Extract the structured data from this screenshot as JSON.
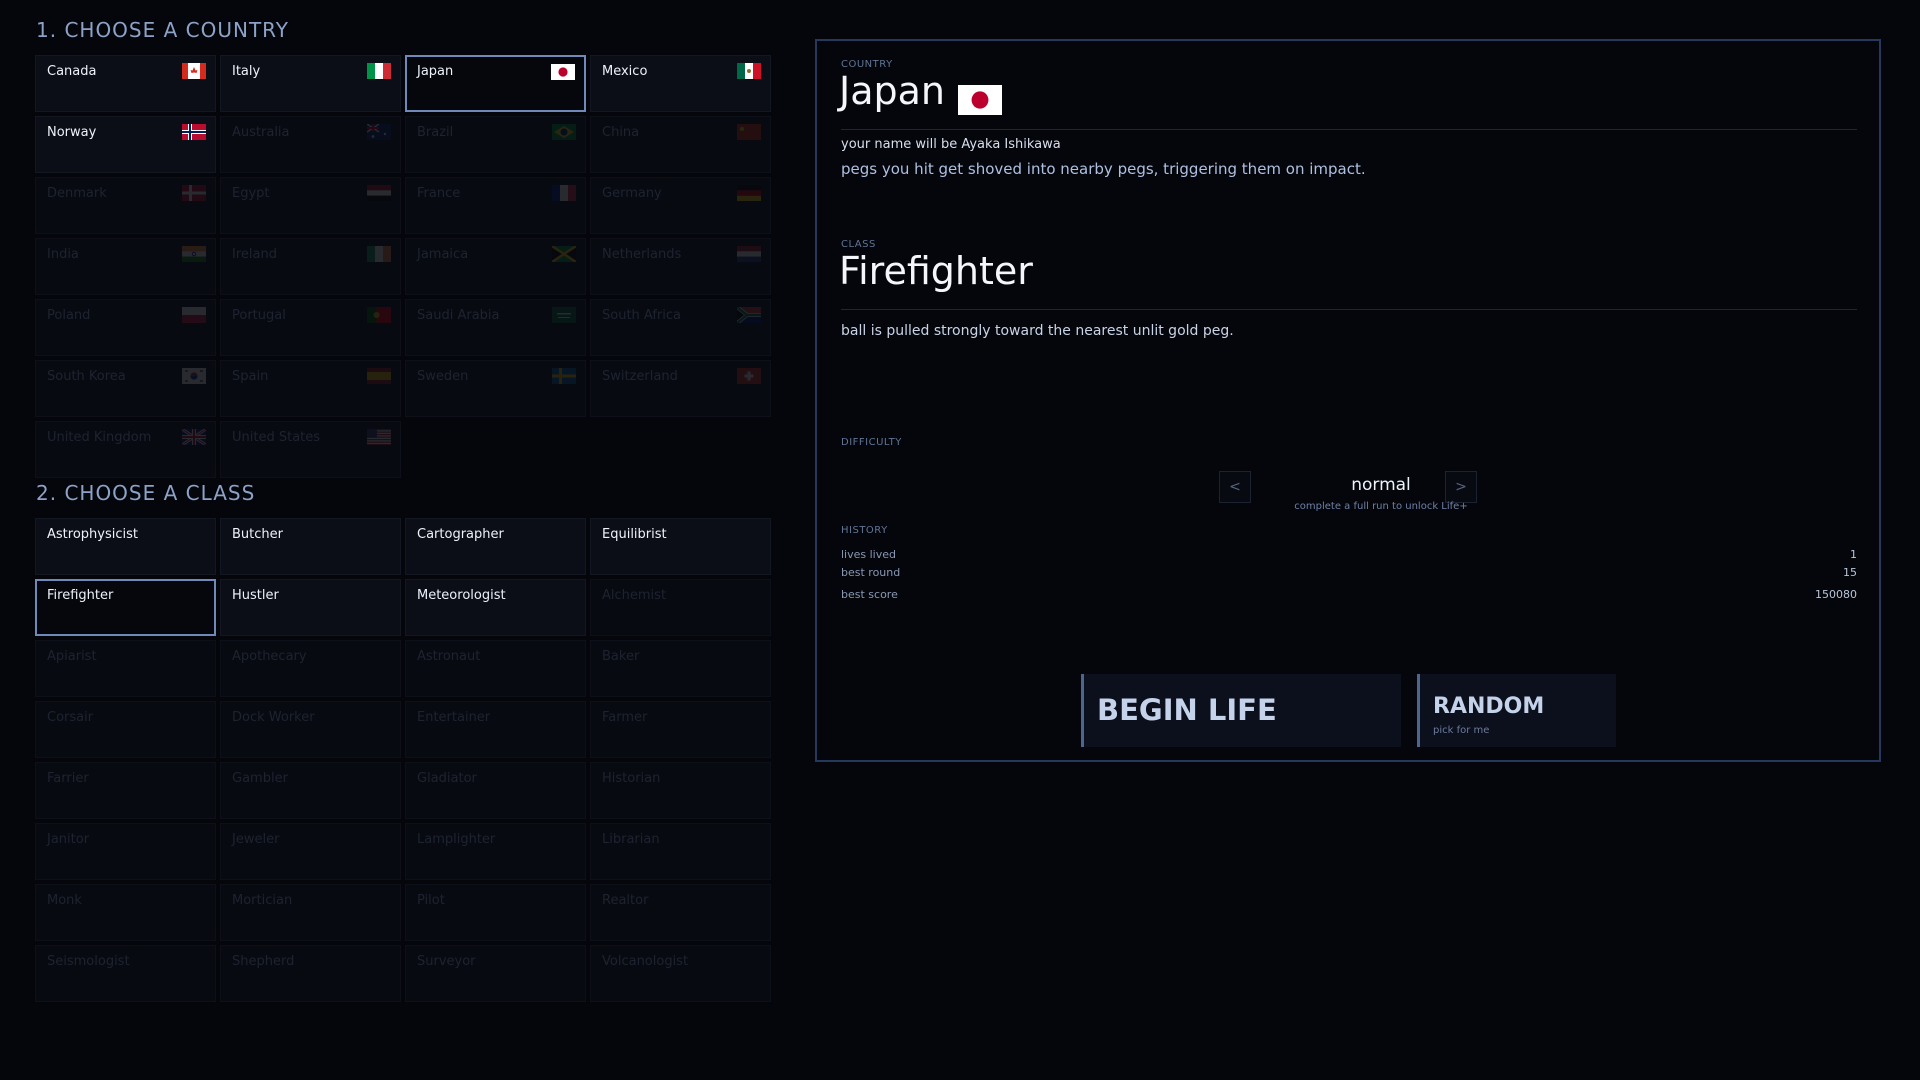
{
  "sections": {
    "country_title": "1.  CHOOSE A COUNTRY",
    "class_title": "2.  CHOOSE A CLASS"
  },
  "countries": [
    {
      "label": "Canada",
      "flag": "canada-flag-icon",
      "state": "unlocked"
    },
    {
      "label": "Italy",
      "flag": "italy-flag-icon",
      "state": "unlocked"
    },
    {
      "label": "Japan",
      "flag": "japan-flag-icon",
      "state": "selected"
    },
    {
      "label": "Mexico",
      "flag": "mexico-flag-icon",
      "state": "unlocked"
    },
    {
      "label": "Norway",
      "flag": "norway-flag-icon",
      "state": "unlocked"
    },
    {
      "label": "Australia",
      "flag": "australia-flag-icon",
      "state": "locked"
    },
    {
      "label": "Brazil",
      "flag": "brazil-flag-icon",
      "state": "locked"
    },
    {
      "label": "China",
      "flag": "china-flag-icon",
      "state": "locked"
    },
    {
      "label": "Denmark",
      "flag": "denmark-flag-icon",
      "state": "locked"
    },
    {
      "label": "Egypt",
      "flag": "egypt-flag-icon",
      "state": "locked"
    },
    {
      "label": "France",
      "flag": "france-flag-icon",
      "state": "locked"
    },
    {
      "label": "Germany",
      "flag": "germany-flag-icon",
      "state": "locked"
    },
    {
      "label": "India",
      "flag": "india-flag-icon",
      "state": "locked"
    },
    {
      "label": "Ireland",
      "flag": "ireland-flag-icon",
      "state": "locked"
    },
    {
      "label": "Jamaica",
      "flag": "jamaica-flag-icon",
      "state": "locked"
    },
    {
      "label": "Netherlands",
      "flag": "netherlands-flag-icon",
      "state": "locked"
    },
    {
      "label": "Poland",
      "flag": "poland-flag-icon",
      "state": "locked"
    },
    {
      "label": "Portugal",
      "flag": "portugal-flag-icon",
      "state": "locked"
    },
    {
      "label": "Saudi Arabia",
      "flag": "saudi-arabia-flag-icon",
      "state": "locked"
    },
    {
      "label": "South Africa",
      "flag": "south-africa-flag-icon",
      "state": "locked"
    },
    {
      "label": "South Korea",
      "flag": "south-korea-flag-icon",
      "state": "locked"
    },
    {
      "label": "Spain",
      "flag": "spain-flag-icon",
      "state": "locked"
    },
    {
      "label": "Sweden",
      "flag": "sweden-flag-icon",
      "state": "locked"
    },
    {
      "label": "Switzerland",
      "flag": "switzerland-flag-icon",
      "state": "locked"
    },
    {
      "label": "United Kingdom",
      "flag": "united-kingdom-flag-icon",
      "state": "locked"
    },
    {
      "label": "United States",
      "flag": "united-states-flag-icon",
      "state": "locked"
    }
  ],
  "classes": [
    {
      "label": "Astrophysicist",
      "state": "unlocked"
    },
    {
      "label": "Butcher",
      "state": "unlocked"
    },
    {
      "label": "Cartographer",
      "state": "unlocked"
    },
    {
      "label": "Equilibrist",
      "state": "unlocked"
    },
    {
      "label": "Firefighter",
      "state": "selected"
    },
    {
      "label": "Hustler",
      "state": "unlocked"
    },
    {
      "label": "Meteorologist",
      "state": "unlocked"
    },
    {
      "label": "Alchemist",
      "state": "locked"
    },
    {
      "label": "Apiarist",
      "state": "locked"
    },
    {
      "label": "Apothecary",
      "state": "locked"
    },
    {
      "label": "Astronaut",
      "state": "locked"
    },
    {
      "label": "Baker",
      "state": "locked"
    },
    {
      "label": "Corsair",
      "state": "locked"
    },
    {
      "label": "Dock Worker",
      "state": "locked"
    },
    {
      "label": "Entertainer",
      "state": "locked"
    },
    {
      "label": "Farmer",
      "state": "locked"
    },
    {
      "label": "Farrier",
      "state": "locked"
    },
    {
      "label": "Gambler",
      "state": "locked"
    },
    {
      "label": "Gladiator",
      "state": "locked"
    },
    {
      "label": "Historian",
      "state": "locked"
    },
    {
      "label": "Janitor",
      "state": "locked"
    },
    {
      "label": "Jeweler",
      "state": "locked"
    },
    {
      "label": "Lamplighter",
      "state": "locked"
    },
    {
      "label": "Librarian",
      "state": "locked"
    },
    {
      "label": "Monk",
      "state": "locked"
    },
    {
      "label": "Mortician",
      "state": "locked"
    },
    {
      "label": "Pilot",
      "state": "locked"
    },
    {
      "label": "Realtor",
      "state": "locked"
    },
    {
      "label": "Seismologist",
      "state": "locked"
    },
    {
      "label": "Shepherd",
      "state": "locked"
    },
    {
      "label": "Surveyor",
      "state": "locked"
    },
    {
      "label": "Volcanologist",
      "state": "locked"
    }
  ],
  "details": {
    "country_label": "COUNTRY",
    "country_name": "Japan",
    "country_flag": "japan-flag-icon",
    "name_line": "your name will be Ayaka Ishikawa",
    "country_effect": "pegs you hit get shoved into nearby pegs, triggering them on impact.",
    "class_label": "CLASS",
    "class_name": "Firefighter",
    "class_effect": "ball is pulled strongly toward the nearest unlit gold peg.",
    "difficulty_label": "DIFFICULTY",
    "difficulty_prev": "<",
    "difficulty_value": "normal",
    "difficulty_next": ">",
    "difficulty_hint": "complete a full run to unlock Life+",
    "history_label": "HISTORY",
    "history": [
      {
        "label": "lives lived",
        "value": "1"
      },
      {
        "label": "best round",
        "value": "15"
      },
      {
        "label": "best score",
        "value": "150080"
      }
    ],
    "begin_label": "BEGIN LIFE",
    "random_label": "RANDOM",
    "random_sub": "pick for me"
  },
  "colors": {
    "background": "#04060c",
    "accent": "#6f8ab8",
    "section_title": "#8ca2c6"
  }
}
